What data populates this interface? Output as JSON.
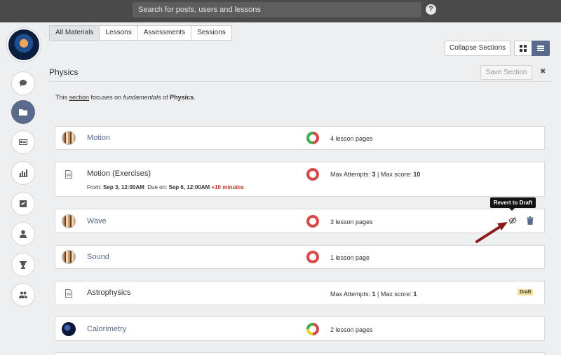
{
  "topbar": {
    "search_placeholder": "Search for posts, users and lessons",
    "help_label": "?"
  },
  "tabs": [
    {
      "label": "All Materials",
      "active": true
    },
    {
      "label": "Lessons"
    },
    {
      "label": "Assessments"
    },
    {
      "label": "Sessions"
    }
  ],
  "toolbar": {
    "collapse_label": "Collapse Sections"
  },
  "section": {
    "title": "Physics",
    "save_label": "Save Section",
    "close_label": "✖",
    "desc": {
      "p1": "This ",
      "link": "section",
      "p2": " focuses on ",
      "em": "fundamentals",
      "p3": " of ",
      "strong": "Physics",
      "p4": "."
    }
  },
  "rail": [
    "chat-icon",
    "folder-icon",
    "newspaper-icon",
    "chart-icon",
    "checkbox-icon",
    "user-icon",
    "trophy-icon",
    "users-icon"
  ],
  "items": [
    {
      "title": "Motion",
      "meta": "4 lesson pages"
    },
    {
      "title": "Motion (Exercises)",
      "meta": {
        "attempts_label": "Max Attempts: ",
        "attempts": "3",
        "sep": " | Max score: ",
        "score": "10"
      },
      "dates": {
        "from_label": "From: ",
        "from": "Sep 3, 12:00AM",
        "due_label": "  Due on: ",
        "due": "Sep 6, 12:00AM",
        "extra": "+10 minutes"
      }
    },
    {
      "title": "Wave",
      "meta": "3 lesson pages"
    },
    {
      "title": "Sound",
      "meta": "1 lesson page"
    },
    {
      "title": "Astrophysics",
      "meta": {
        "attempts_label": "Max Attempts: ",
        "attempts": "1",
        "sep": " | Max score: ",
        "score": "1"
      },
      "badge": "Draft"
    },
    {
      "title": "Calorimetry",
      "meta": "2 lesson pages"
    }
  ],
  "tooltip": "Revert to Draft",
  "colors": {
    "topbar": "#4a4a4a",
    "accent": "#5a6a8c",
    "ring_red": "#d84a4a",
    "ring_green": "#3cb04a",
    "arrow": "#8b1a1a"
  }
}
